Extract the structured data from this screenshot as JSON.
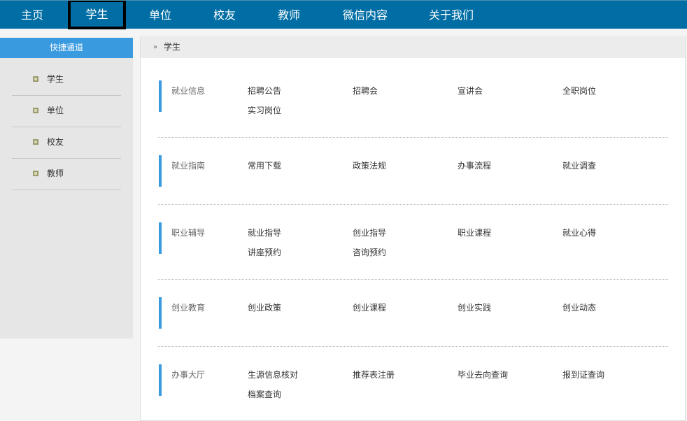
{
  "nav": {
    "items": [
      {
        "label": "主页"
      },
      {
        "label": "学生"
      },
      {
        "label": "单位"
      },
      {
        "label": "校友"
      },
      {
        "label": "教师"
      },
      {
        "label": "微信内容"
      },
      {
        "label": "关于我们"
      }
    ],
    "active": "学生"
  },
  "sidebar": {
    "title": "快捷通道",
    "items": [
      {
        "label": "学生"
      },
      {
        "label": "单位"
      },
      {
        "label": "校友"
      },
      {
        "label": "教师"
      }
    ]
  },
  "breadcrumb": {
    "icon": "double-chevron-right-icon",
    "text": "学生"
  },
  "sections": [
    {
      "title": "就业信息",
      "links": [
        "招聘公告",
        "招聘会",
        "宣讲会",
        "全职岗位",
        "实习岗位"
      ]
    },
    {
      "title": "就业指南",
      "links": [
        "常用下载",
        "政策法规",
        "办事流程",
        "就业调查"
      ]
    },
    {
      "title": "职业辅导",
      "links": [
        "就业指导",
        "创业指导",
        "职业课程",
        "就业心得",
        "讲座预约",
        "咨询预约"
      ]
    },
    {
      "title": "创业教育",
      "links": [
        "创业政策",
        "创业课程",
        "创业实践",
        "创业动态"
      ]
    },
    {
      "title": "办事大厅",
      "links": [
        "生源信息核对",
        "推荐表注册",
        "毕业去向查询",
        "报到证查询",
        "档案查询"
      ]
    }
  ],
  "colors": {
    "nav_bg": "#006ea4",
    "accent": "#3a9ae0",
    "sidebar_bg": "#e6e6e6"
  }
}
